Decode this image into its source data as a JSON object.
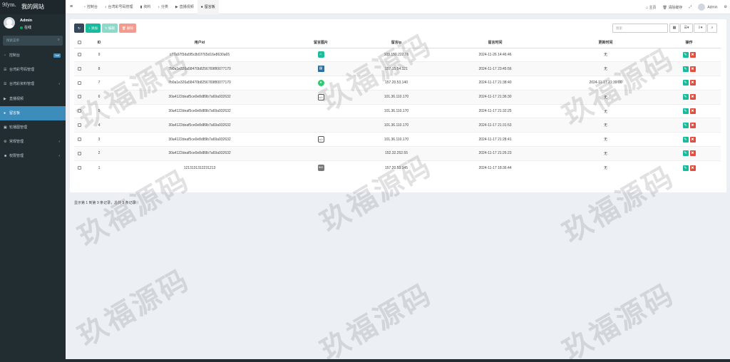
{
  "site_tag": "9fym.",
  "sidebar": {
    "brand": "我的网站",
    "user_name": "Admin",
    "user_status": "在线",
    "search_placeholder": "搜索菜单",
    "items": [
      {
        "label": "控制台",
        "icon": "dashboard-icon",
        "badge": "hot"
      },
      {
        "label": "台湾彩号码管理",
        "icon": "list-icon"
      },
      {
        "label": "台湾彩资料管理",
        "icon": "list-icon",
        "caret": "‹"
      },
      {
        "label": "直播视频",
        "icon": "video-icon"
      },
      {
        "label": "留言板",
        "icon": "comment-icon",
        "active": true
      },
      {
        "label": "轮播图管理",
        "icon": "image-icon"
      },
      {
        "label": "常规管理",
        "icon": "cogs-icon",
        "caret": "‹"
      },
      {
        "label": "权限管理",
        "icon": "group-icon",
        "caret": "‹"
      }
    ]
  },
  "topbar": {
    "tabs": [
      {
        "label": "控制台",
        "icon": "dashboard-icon"
      },
      {
        "label": "台湾彩号码管理",
        "icon": "bell-icon"
      },
      {
        "label": "资料",
        "icon": "bookmark-icon"
      },
      {
        "label": "分类",
        "icon": "bell-icon"
      },
      {
        "label": "直播视频",
        "icon": "video-icon"
      },
      {
        "label": "留言板",
        "icon": "comment-icon",
        "active": true
      }
    ],
    "home": "主页",
    "clear_cache": "清除缓存",
    "admin": "Admin"
  },
  "toolbar": {
    "add": "添加",
    "edit": "编辑",
    "delete": "删除",
    "search_placeholder": "搜索"
  },
  "table": {
    "headers": [
      "ID",
      "用户id",
      "留言图片",
      "留言ip",
      "留言时间",
      "更新时间",
      "操作"
    ],
    "rows": [
      {
        "id": "9",
        "uid": "c77a97f3da5f5c8d1f765d16e8630a65",
        "img": "teal",
        "ip": "103.150.222.76",
        "time": "2024-11-26 14:46:46",
        "updated": "无"
      },
      {
        "id": "8",
        "uid": "7b0a1e326a58470b8256769f80077170",
        "img": "blue",
        "ip": "157.15.54.121",
        "time": "2024-11-17 23:45:56",
        "updated": "无"
      },
      {
        "id": "7",
        "uid": "7b0a1e326a58470b8256769f80077170",
        "img": "green",
        "ip": "157.20.53.140",
        "time": "2024-11-17 21:38:40",
        "updated": "2024-11-17 21:39:00"
      },
      {
        "id": "6",
        "uid": "30a4122deaf5ce0e8d89b7a69a932632",
        "img": "code",
        "ip": "101.36.110.170",
        "time": "2024-11-17 21:36:30",
        "updated": "无"
      },
      {
        "id": "5",
        "uid": "30a4122deaf5ce0e8d89b7a69a932632",
        "img": "",
        "ip": "101.36.110.170",
        "time": "2024-11-17 21:32:25",
        "updated": "无"
      },
      {
        "id": "4",
        "uid": "30a4122deaf5ce0e8d89b7a69a932632",
        "img": "",
        "ip": "101.36.110.170",
        "time": "2024-11-17 21:31:53",
        "updated": "无"
      },
      {
        "id": "3",
        "uid": "30a4122deaf5ce0e8d89b7a69a932632",
        "img": "code",
        "ip": "101.36.110.170",
        "time": "2024-11-17 21:28:41",
        "updated": "无"
      },
      {
        "id": "2",
        "uid": "30a4122deaf5ce0e8d89b7a69a932632",
        "img": "",
        "ip": "152.32.252.55",
        "time": "2024-11-17 21:26:23",
        "updated": "无"
      },
      {
        "id": "1",
        "uid": "1213131312231213",
        "img": "gray",
        "ip": "157.20.53.145",
        "time": "2024-11-17 18:36:44",
        "updated": "无"
      }
    ]
  },
  "summary": "显示第 1 到第 9 条记录，总共 9 条记录",
  "watermark": "玖福源码"
}
